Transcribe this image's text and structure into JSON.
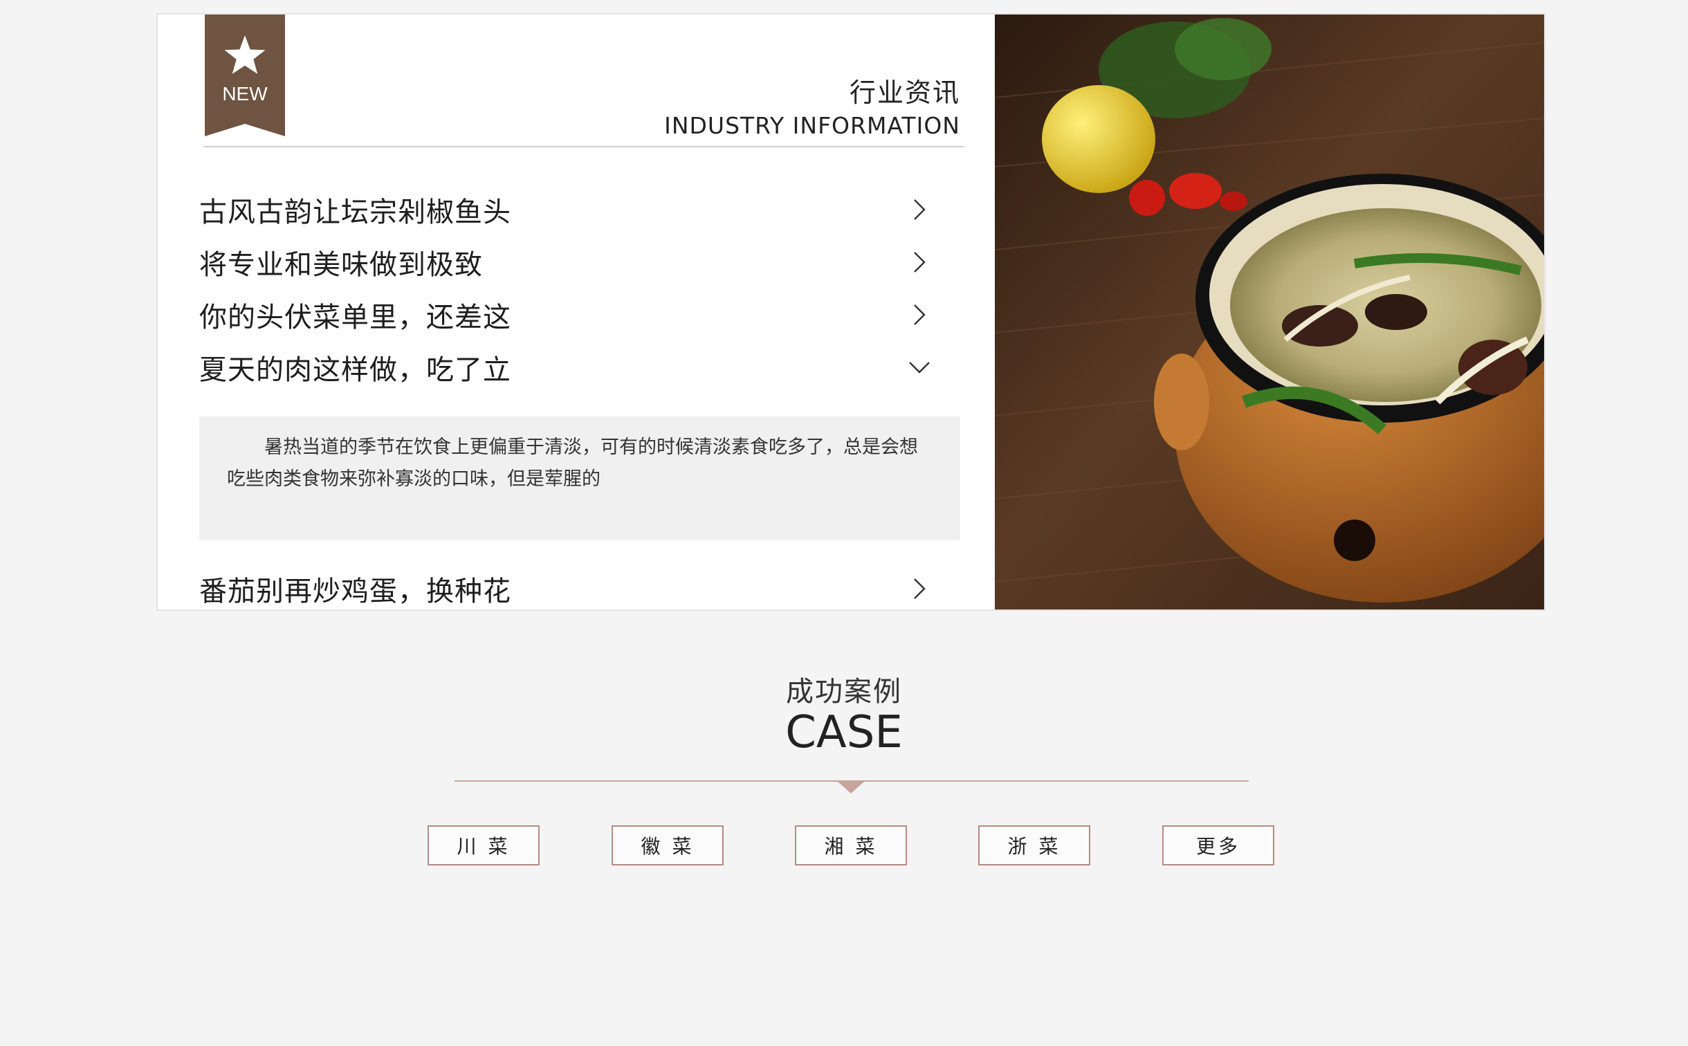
{
  "industry": {
    "badge_label": "NEW",
    "title_cn": "行业资讯",
    "title_en": "INDUSTRY INFORMATION",
    "items": [
      {
        "label": "古风古韵让坛宗剁椒鱼头",
        "icon": "chevron-right-icon"
      },
      {
        "label": "将专业和美味做到极致",
        "icon": "chevron-right-icon"
      },
      {
        "label": "你的头伏菜单里，还差这",
        "icon": "chevron-right-icon"
      },
      {
        "label": "夏天的肉这样做，吃了立",
        "icon": "chevron-down-icon"
      },
      {
        "label": "番茄别再炒鸡蛋，换种花",
        "icon": "chevron-right-icon"
      }
    ],
    "expanded_summary": "暑热当道的季节在饮食上更偏重于清淡，可有的时候清淡素食吃多了，总是会想吃些肉类食物来弥补寡淡的口味，但是荤腥的",
    "photo": "claypot-soup-photo"
  },
  "case": {
    "title_cn": "成功案例",
    "title_en": "CASE",
    "tabs": [
      "川 菜",
      "徽 菜",
      "湘 菜",
      "浙 菜",
      "更多"
    ]
  },
  "colors": {
    "badge": "#6e5441",
    "accent_rule": "#c7a49c",
    "tab_border": "#b68b84",
    "background": "#f4f4f4"
  }
}
